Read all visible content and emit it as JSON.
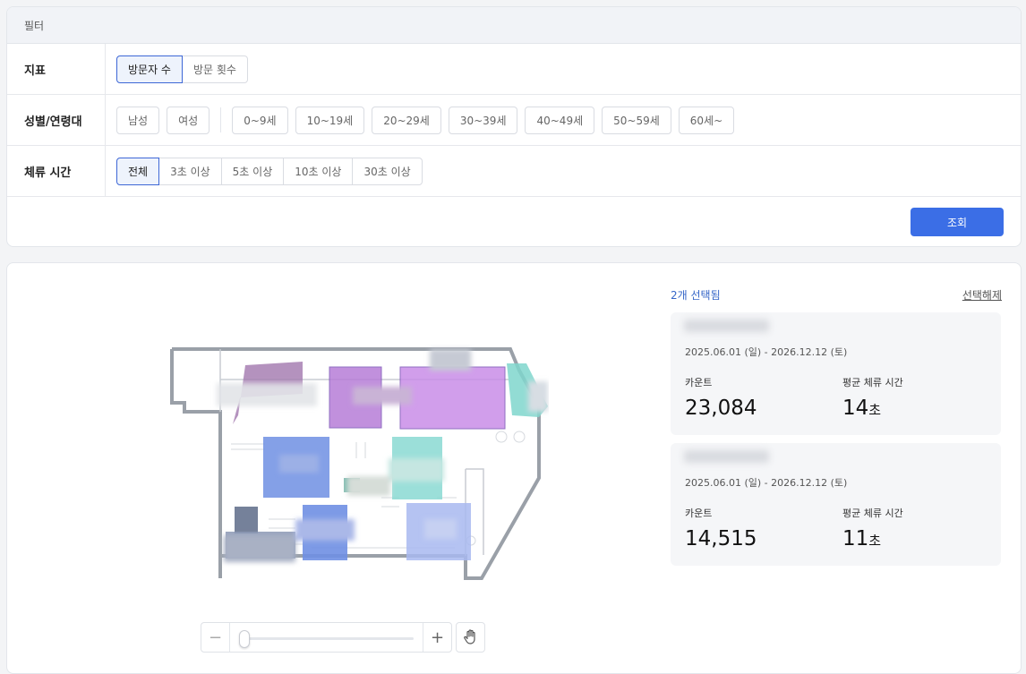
{
  "filter": {
    "title": "필터",
    "metric": {
      "label": "지표",
      "options": [
        "방문자 수",
        "방문 횟수"
      ],
      "selected": "방문자 수"
    },
    "demographic": {
      "label": "성별/연령대",
      "gender": [
        "남성",
        "여성"
      ],
      "ages": [
        "0~9세",
        "10~19세",
        "20~29세",
        "30~39세",
        "40~49세",
        "50~59세",
        "60세~"
      ]
    },
    "dwell": {
      "label": "체류 시간",
      "options": [
        "전체",
        "3초 이상",
        "5초 이상",
        "10초 이상",
        "30초 이상"
      ],
      "selected": "전체"
    },
    "query_label": "조회"
  },
  "panel": {
    "selected_text": "2개 선택됨",
    "clear_label": "선택해제",
    "stores": [
      {
        "period": "2025.06.01 (일) - 2026.12.12 (토)",
        "count_label": "카운트",
        "count": "23,084",
        "dwell_label": "평균 체류 시간",
        "dwell_value": "14",
        "dwell_unit": "초"
      },
      {
        "period": "2025.06.01 (일) - 2026.12.12 (토)",
        "count_label": "카운트",
        "count": "14,515",
        "dwell_label": "평균 체류 시간",
        "dwell_value": "11",
        "dwell_unit": "초"
      }
    ]
  },
  "zoom": {
    "minus": "−",
    "plus": "+",
    "level": 0.0
  },
  "icons": {
    "hand": "hand-pan-icon"
  },
  "colors": {
    "accent": "#3b6ee6",
    "zone_purple": "#b77dd8",
    "zone_blue": "#6f8fe3",
    "zone_teal": "#7fd6cc"
  }
}
